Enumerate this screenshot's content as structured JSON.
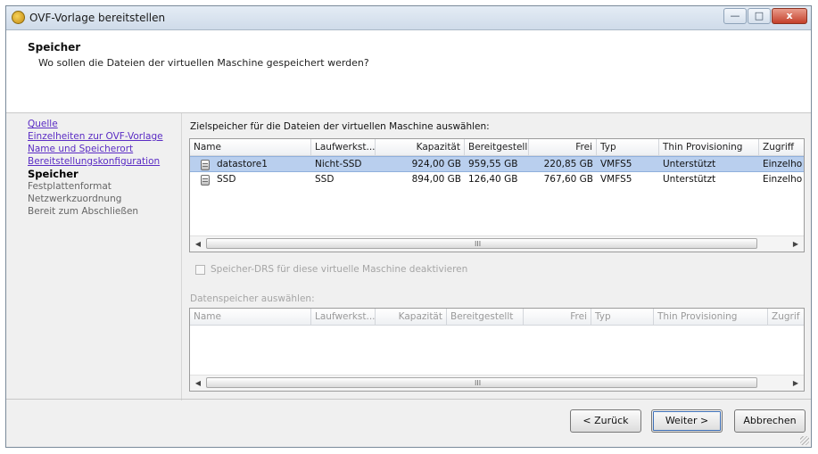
{
  "window": {
    "title": "OVF-Vorlage bereitstellen",
    "controls": {
      "minimize": "—",
      "maximize": "□",
      "close": "x"
    }
  },
  "header": {
    "title": "Speicher",
    "subtitle": "Wo sollen die Dateien der virtuellen Maschine gespeichert werden?"
  },
  "nav": {
    "items": [
      {
        "label": "Quelle",
        "state": "link"
      },
      {
        "label": "Einzelheiten zur OVF-Vorlage",
        "state": "link"
      },
      {
        "label": "Name und Speicherort",
        "state": "link"
      },
      {
        "label": "Bereitstellungskonfiguration",
        "state": "link"
      },
      {
        "label": "Speicher",
        "state": "current"
      },
      {
        "label": "Festplattenformat",
        "state": "pending"
      },
      {
        "label": "Netzwerkzuordnung",
        "state": "pending"
      },
      {
        "label": "Bereit zum Abschließen",
        "state": "pending"
      }
    ]
  },
  "main": {
    "target_label": "Zielspeicher für die Dateien der virtuellen Maschine auswählen:",
    "columns": [
      "Name",
      "Laufwerkst...",
      "Kapazität",
      "Bereitgestell",
      "Frei",
      "Typ",
      "Thin Provisioning",
      "Zugriff"
    ],
    "rows": [
      {
        "name": "datastore1",
        "drive_type": "Nicht-SSD",
        "capacity": "924,00 GB",
        "provisioned": "959,55 GB",
        "free": "220,85 GB",
        "type": "VMFS5",
        "thin": "Unterstützt",
        "access": "Einzelho",
        "selected": true
      },
      {
        "name": "SSD",
        "drive_type": "SSD",
        "capacity": "894,00 GB",
        "provisioned": "126,40 GB",
        "free": "767,60 GB",
        "type": "VMFS5",
        "thin": "Unterstützt",
        "access": "Einzelho",
        "selected": false
      }
    ],
    "scroll_grip": "III",
    "drs_checkbox": {
      "label": "Speicher-DRS für diese virtuelle Maschine deaktivieren",
      "checked": false
    },
    "datastore_label": "Datenspeicher auswählen:",
    "columns2": [
      "Name",
      "Laufwerkst...",
      "Kapazität",
      "Bereitgestellt",
      "Frei",
      "Typ",
      "Thin Provisioning",
      "Zugrif"
    ]
  },
  "footer": {
    "back_label": "< Zurück",
    "next_label": "Weiter >",
    "cancel_label": "Abbrechen"
  },
  "colors": {
    "selection": "#b9cfee",
    "link": "#5a2cc4"
  }
}
